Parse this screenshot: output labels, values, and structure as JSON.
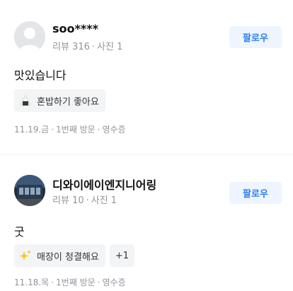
{
  "reviews": [
    {
      "username": "soo****",
      "review_count_label": "리뷰 316",
      "photo_count_label": "사진 1",
      "follow_label": "팔로우",
      "avatar_icon": "default-avatar-icon",
      "text": "맛있습니다",
      "tags": [
        {
          "icon": "rice-ball-icon",
          "label": "혼밥하기 좋아요"
        }
      ],
      "visit_date": "11.19.금",
      "visit_count": "1번째 방문",
      "verification": "영수증"
    },
    {
      "username": "디와이에이엔지니어링",
      "review_count_label": "리뷰 10",
      "photo_count_label": "사진 1",
      "follow_label": "팔로우",
      "avatar_icon": "building-photo-avatar",
      "text": "굿",
      "tags": [
        {
          "icon": "sparkles-icon",
          "label": "매장이 청결해요"
        }
      ],
      "more_tags_label": "+1",
      "visit_date": "11.18.목",
      "visit_count": "1번째 방문",
      "verification": "영수증"
    }
  ],
  "colors": {
    "follow_text": "#2f80ed",
    "follow_bg": "#eef5ff",
    "meta_text": "#8f959c",
    "tag_bg": "#f2f4f6"
  }
}
